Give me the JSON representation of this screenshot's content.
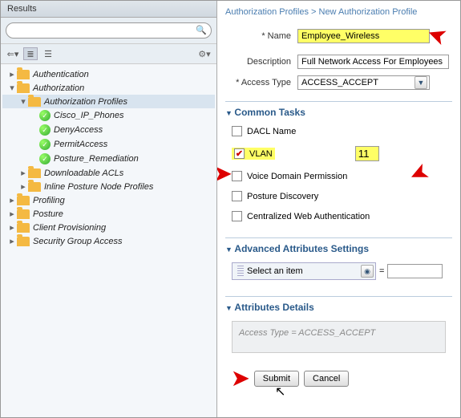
{
  "leftPanel": {
    "title": "Results",
    "searchPlaceholder": "",
    "tree": {
      "authentication": "Authentication",
      "authorization": "Authorization",
      "authProfiles": "Authorization Profiles",
      "items": [
        "Cisco_IP_Phones",
        "DenyAccess",
        "PermitAccess",
        "Posture_Remediation"
      ],
      "downloadable": "Downloadable ACLs",
      "inline": "Inline Posture Node Profiles",
      "profiling": "Profiling",
      "posture": "Posture",
      "clientProv": "Client Provisioning",
      "secGroup": "Security Group Access"
    }
  },
  "breadcrumb": {
    "parent": "Authorization Profiles",
    "current": "New Authorization Profile"
  },
  "form": {
    "nameLabel": "Name",
    "nameValue": "Employee_Wireless",
    "descLabel": "Description",
    "descValue": "Full Network Access For Employees",
    "accessTypeLabel": "Access Type",
    "accessTypeValue": "ACCESS_ACCEPT"
  },
  "commonTasks": {
    "header": "Common Tasks",
    "dacl": "DACL Name",
    "vlan": "VLAN",
    "vlanValue": "11",
    "voice": "Voice Domain Permission",
    "posture": "Posture Discovery",
    "webauth": "Centralized Web Authentication"
  },
  "advanced": {
    "header": "Advanced Attributes Settings",
    "placeholder": "Select an item",
    "eq": "="
  },
  "attrDetails": {
    "header": "Attributes Details",
    "content": "Access Type = ACCESS_ACCEPT"
  },
  "buttons": {
    "submit": "Submit",
    "cancel": "Cancel"
  }
}
